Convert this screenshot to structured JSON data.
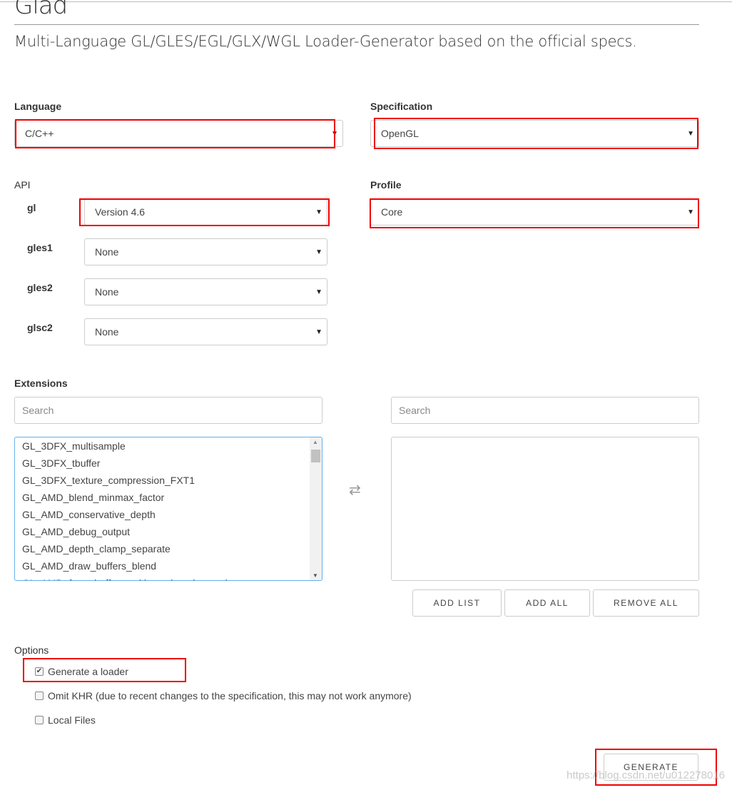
{
  "header": {
    "title": "Glad",
    "subtitle": "Multi-Language GL/GLES/EGL/GLX/WGL Loader-Generator based on the official specs."
  },
  "language": {
    "label": "Language",
    "value": "C/C++"
  },
  "specification": {
    "label": "Specification",
    "value": "OpenGL"
  },
  "api": {
    "label": "API",
    "rows": [
      {
        "name": "gl",
        "value": "Version 4.6"
      },
      {
        "name": "gles1",
        "value": "None"
      },
      {
        "name": "gles2",
        "value": "None"
      },
      {
        "name": "glsc2",
        "value": "None"
      }
    ]
  },
  "profile": {
    "label": "Profile",
    "value": "Core"
  },
  "extensions": {
    "label": "Extensions",
    "search_left_placeholder": "Search",
    "search_right_placeholder": "Search",
    "items": [
      "GL_3DFX_multisample",
      "GL_3DFX_tbuffer",
      "GL_3DFX_texture_compression_FXT1",
      "GL_AMD_blend_minmax_factor",
      "GL_AMD_conservative_depth",
      "GL_AMD_debug_output",
      "GL_AMD_depth_clamp_separate",
      "GL_AMD_draw_buffers_blend",
      "GL_AMD_framebuffer_multisample_advanced"
    ],
    "add_list": "ADD LIST",
    "add_all": "ADD ALL",
    "remove_all": "REMOVE ALL"
  },
  "options": {
    "label": "Options",
    "items": [
      {
        "label": "Generate a loader",
        "checked": true
      },
      {
        "label": "Omit KHR (due to recent changes to the specification, this may not work anymore)",
        "checked": false
      },
      {
        "label": "Local Files",
        "checked": false
      }
    ]
  },
  "generate": "GENERATE",
  "watermark": "https://blog.csdn.net/u012278016",
  "colors": {
    "highlight": "#ee0000",
    "focus": "#66afe9"
  }
}
